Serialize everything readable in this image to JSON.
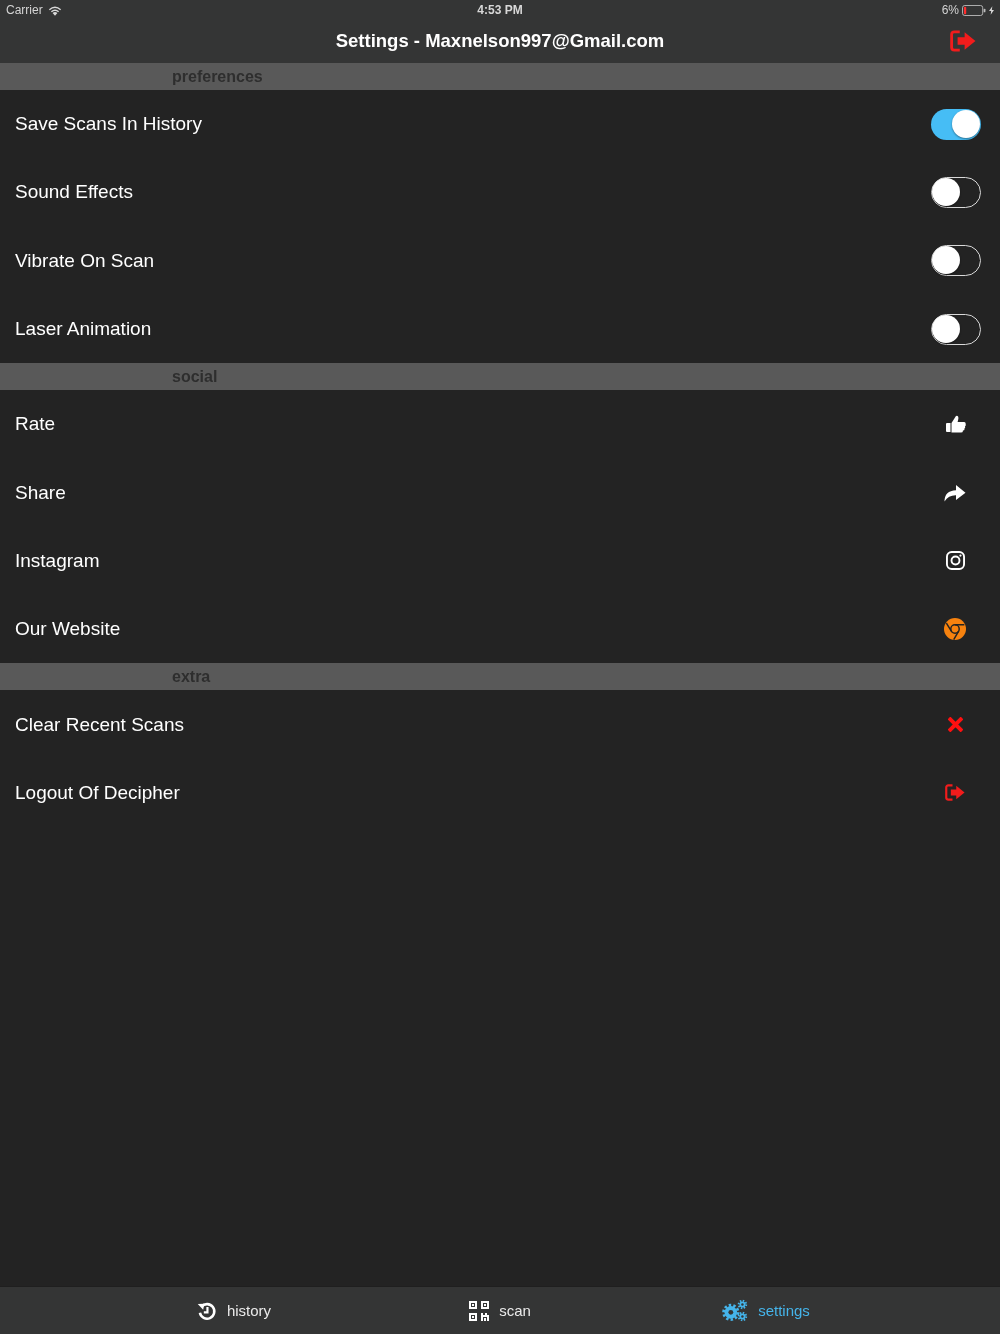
{
  "status_bar": {
    "carrier": "Carrier",
    "time": "4:53 PM",
    "battery_percent": "6%"
  },
  "nav_bar": {
    "title": "Settings - Maxnelson997@Gmail.com"
  },
  "sections": [
    {
      "title": "preferences",
      "rows": [
        {
          "label": "Save Scans In History",
          "kind": "toggle",
          "on": true
        },
        {
          "label": "Sound Effects",
          "kind": "toggle",
          "on": false
        },
        {
          "label": "Vibrate On Scan",
          "kind": "toggle",
          "on": false
        },
        {
          "label": "Laser Animation",
          "kind": "toggle",
          "on": false
        }
      ]
    },
    {
      "title": "social",
      "rows": [
        {
          "label": "Rate",
          "kind": "rate"
        },
        {
          "label": "Share",
          "kind": "share"
        },
        {
          "label": "Instagram",
          "kind": "instagram"
        },
        {
          "label": "Our Website",
          "kind": "website"
        }
      ]
    },
    {
      "title": "extra",
      "rows": [
        {
          "label": "Clear Recent Scans",
          "kind": "clear"
        },
        {
          "label": "Logout Of Decipher",
          "kind": "logout"
        }
      ]
    }
  ],
  "tabs": [
    {
      "label": "history",
      "kind": "history",
      "selected": false
    },
    {
      "label": "scan",
      "kind": "scan",
      "selected": false
    },
    {
      "label": "settings",
      "kind": "settings",
      "selected": true
    }
  ]
}
